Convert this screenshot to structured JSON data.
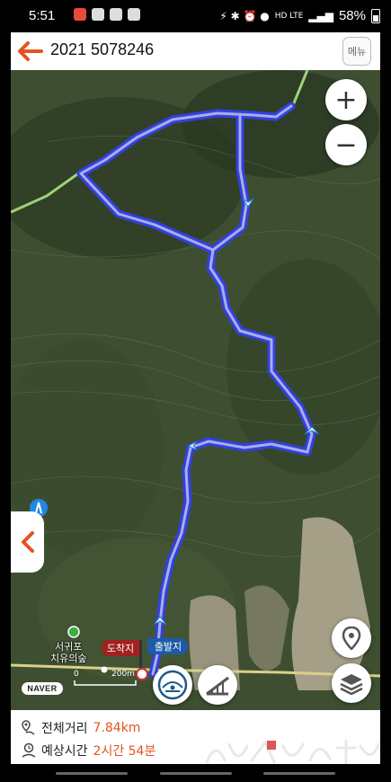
{
  "status_bar": {
    "time": "5:51",
    "network": "HD LTE",
    "battery": "58%"
  },
  "header": {
    "title": "2021 5078246",
    "menu_label": "메뉴"
  },
  "map": {
    "zoom_in": "+",
    "zoom_out": "−",
    "poi_name_line1": "서귀포",
    "poi_name_line2": "치유의숲",
    "end_flag_label": "도착지",
    "start_flag_label": "출발지",
    "scale_zero": "0",
    "scale_distance": "200m",
    "provider_logo": "NAVER",
    "route_color": "#2b3fd6"
  },
  "info": {
    "distance_label": "전체거리",
    "distance_value": "7.84km",
    "time_label": "예상시간",
    "time_value": "2시간 54분"
  },
  "colors": {
    "accent": "#e2541f",
    "route": "#2b3fd6"
  }
}
